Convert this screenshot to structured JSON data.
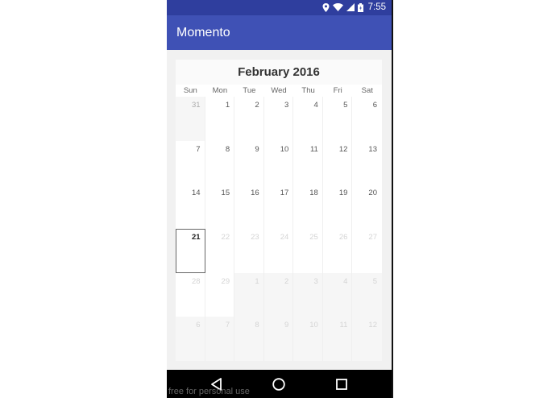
{
  "status_bar": {
    "time": "7:55",
    "icons": [
      "location-icon",
      "wifi-icon",
      "signal-icon",
      "battery-icon"
    ]
  },
  "app_bar": {
    "title": "Momento"
  },
  "calendar": {
    "month_title": "February 2016",
    "weekdays": [
      "Sun",
      "Mon",
      "Tue",
      "Wed",
      "Thu",
      "Fri",
      "Sat"
    ],
    "weeks": [
      [
        "31",
        "1",
        "2",
        "3",
        "4",
        "5",
        "6"
      ],
      [
        "7",
        "8",
        "9",
        "10",
        "11",
        "12",
        "13"
      ],
      [
        "14",
        "15",
        "16",
        "17",
        "18",
        "19",
        "20"
      ],
      [
        "21",
        "22",
        "23",
        "24",
        "25",
        "26",
        "27"
      ],
      [
        "28",
        "29",
        "1",
        "2",
        "3",
        "4",
        "5"
      ],
      [
        "6",
        "7",
        "8",
        "9",
        "10",
        "11",
        "12"
      ]
    ],
    "today": "21"
  },
  "nav_bar": {
    "buttons": [
      "back-icon",
      "home-icon",
      "recents-icon"
    ]
  },
  "watermark": "free for personal use",
  "colors": {
    "status_bar": "#2f3e9e",
    "app_bar": "#3f51b5",
    "nav_bar": "#000000"
  }
}
